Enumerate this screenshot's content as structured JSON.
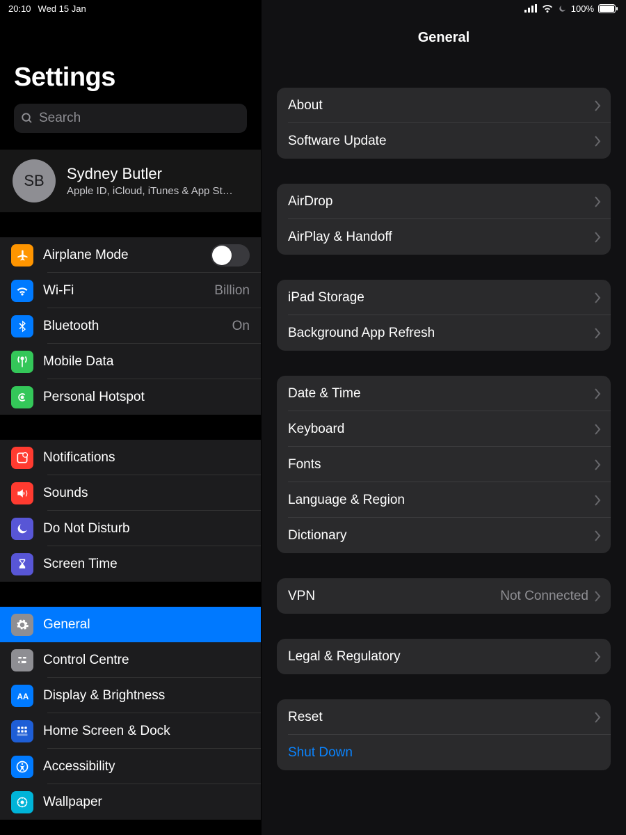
{
  "status": {
    "time": "20:10",
    "date": "Wed 15 Jan",
    "battery": "100%"
  },
  "sidebar": {
    "title": "Settings",
    "search_placeholder": "Search",
    "profile": {
      "initials": "SB",
      "name": "Sydney Butler",
      "sub": "Apple ID, iCloud, iTunes & App St…"
    },
    "g1": {
      "airplane": "Airplane Mode",
      "wifi": "Wi-Fi",
      "wifi_val": "Billion",
      "bt": "Bluetooth",
      "bt_val": "On",
      "mobile": "Mobile Data",
      "hotspot": "Personal Hotspot"
    },
    "g2": {
      "notifications": "Notifications",
      "sounds": "Sounds",
      "dnd": "Do Not Disturb",
      "screentime": "Screen Time"
    },
    "g3": {
      "general": "General",
      "control": "Control Centre",
      "display": "Display & Brightness",
      "home": "Home Screen & Dock",
      "accessibility": "Accessibility",
      "wallpaper": "Wallpaper"
    }
  },
  "detail": {
    "title": "General",
    "s1": {
      "about": "About",
      "sw": "Software Update"
    },
    "s2": {
      "airdrop": "AirDrop",
      "airplay": "AirPlay & Handoff"
    },
    "s3": {
      "storage": "iPad Storage",
      "refresh": "Background App Refresh"
    },
    "s4": {
      "date": "Date & Time",
      "keyboard": "Keyboard",
      "fonts": "Fonts",
      "lang": "Language & Region",
      "dict": "Dictionary"
    },
    "s5": {
      "vpn": "VPN",
      "vpn_val": "Not Connected"
    },
    "s6": {
      "legal": "Legal & Regulatory"
    },
    "s7": {
      "reset": "Reset",
      "shutdown": "Shut Down"
    }
  }
}
